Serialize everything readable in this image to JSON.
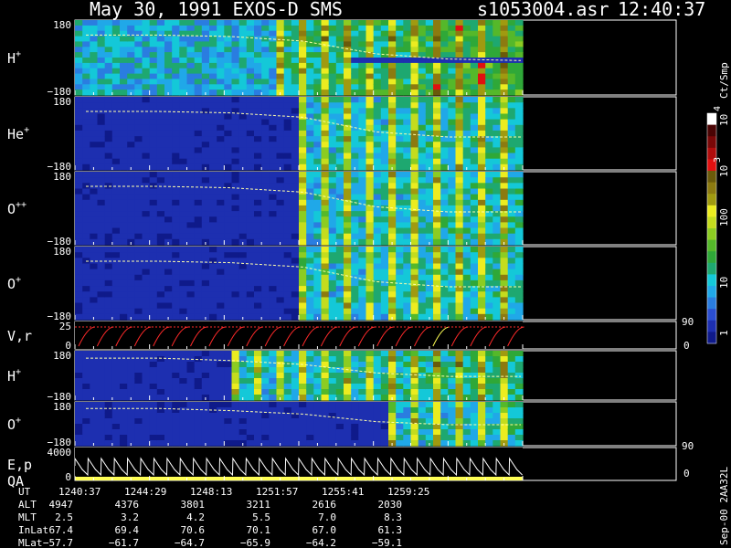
{
  "header": {
    "title": "May 30, 1991   EXOS-D SMS",
    "file": "s1053004.asr",
    "time": "12:40:37"
  },
  "colorbar": {
    "label": "Ct/Smp",
    "tick_labels": [
      "1",
      "10",
      "100",
      "10",
      "3",
      "10",
      "4"
    ],
    "levels": [
      "#0f1a8a",
      "#1d2fb0",
      "#2b4ed0",
      "#2a7de0",
      "#20a8e8",
      "#14c8d8",
      "#1ea870",
      "#2fa838",
      "#55b82a",
      "#8ccc22",
      "#c4dc1e",
      "#ecec20",
      "#a09a10",
      "#8c7a10",
      "#6a5a0a",
      "#e01010",
      "#b00c0c",
      "#7a0808",
      "#4a0404",
      "#ffffff"
    ],
    "colors": {
      "background": "#000000",
      "panel": "#0e1c86",
      "trace": "#ffffaa",
      "flag": "#ffff55",
      "vr": "#ff2a2a"
    }
  },
  "chart_data": {
    "type": "heatmap",
    "title": "May 30, 1991   EXOS-D SMS",
    "file": "s1053004.asr",
    "time": "12:40:37",
    "panels": [
      {
        "name": "H",
        "charge": "+",
        "ylim": [
          -180,
          180
        ],
        "ticks": [
          "180",
          "−180"
        ],
        "activity_start": 0.1,
        "activity_level": 0.55,
        "trace": [
          0.8,
          0.8,
          0.78,
          0.72,
          0.55,
          0.48,
          0.46
        ]
      },
      {
        "name": "He",
        "charge": "+",
        "ylim": [
          -180,
          180
        ],
        "ticks": [
          "180",
          "−180"
        ],
        "activity_start": 0.5,
        "activity_level": 0.35,
        "trace": [
          0.8,
          0.8,
          0.78,
          0.72,
          0.52,
          0.45,
          0.45
        ]
      },
      {
        "name": "O",
        "charge": "++",
        "ylim": [
          -180,
          180
        ],
        "ticks": [
          "180",
          "−180"
        ],
        "activity_start": 0.5,
        "activity_level": 0.35,
        "trace": [
          0.8,
          0.8,
          0.78,
          0.72,
          0.52,
          0.45,
          0.45
        ]
      },
      {
        "name": "O",
        "charge": "+",
        "ylim": [
          -180,
          180
        ],
        "ticks": [
          "180",
          "−180"
        ],
        "activity_start": 0.5,
        "activity_level": 0.35,
        "trace": [
          0.8,
          0.8,
          0.78,
          0.72,
          0.52,
          0.45,
          0.45
        ]
      },
      {
        "name": "V,r",
        "charge": "",
        "ylim": [
          0,
          25
        ],
        "ticks": [
          "25",
          "0"
        ],
        "right_ticks": [
          "90",
          "0"
        ]
      },
      {
        "name": "H",
        "charge": "+",
        "ylim": [
          -180,
          180
        ],
        "ticks": [
          "180",
          "−180"
        ],
        "activity_start": 0.35,
        "activity_level": 0.45,
        "trace": [
          0.85,
          0.85,
          0.8,
          0.72,
          0.55,
          0.48,
          0.48
        ]
      },
      {
        "name": "O",
        "charge": "+",
        "ylim": [
          -180,
          180
        ],
        "ticks": [
          "180",
          "−180"
        ],
        "activity_start": 0.7,
        "activity_level": 0.5,
        "trace": [
          0.85,
          0.85,
          0.8,
          0.72,
          0.55,
          0.48,
          0.48
        ],
        "right_ticks": [
          "90"
        ]
      },
      {
        "name": "E,p",
        "sub": "QA",
        "charge": "",
        "ylim": [
          0,
          4000
        ],
        "ticks": [
          "4000",
          "0"
        ],
        "right_ticks": [
          "0"
        ]
      }
    ],
    "x_labels": [
      "1240:37",
      "1244:29",
      "1248:13",
      "1251:57",
      "1255:41",
      "1259:25"
    ],
    "table": [
      {
        "name": "UT",
        "values": [
          "1240:37",
          "1244:29",
          "1248:13",
          "1251:57",
          "1255:41",
          "1259:25"
        ]
      },
      {
        "name": "ALT",
        "values": [
          "4947",
          "4376",
          "3801",
          "3211",
          "2616",
          "2030"
        ]
      },
      {
        "name": "MLT",
        "values": [
          "2.5",
          "3.2",
          "4.2",
          "5.5",
          "7.0",
          "8.3"
        ]
      },
      {
        "name": "InLat",
        "values": [
          "67.4",
          "69.4",
          "70.6",
          "70.1",
          "67.0",
          "61.3"
        ]
      },
      {
        "name": "MLat",
        "values": [
          "−57.7",
          "−61.7",
          "−64.7",
          "−65.9",
          "−64.2",
          "−59.1"
        ]
      }
    ],
    "footer": "Sep-00 2AA32L"
  }
}
